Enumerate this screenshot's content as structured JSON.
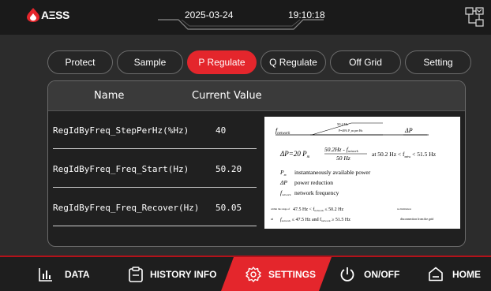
{
  "header": {
    "logo_text": "AΞSS",
    "date": "2025-03-24",
    "time": "19:10:18"
  },
  "tabs": [
    {
      "label": "Protect"
    },
    {
      "label": "Sample"
    },
    {
      "label": "P Regulate"
    },
    {
      "label": "Q Regulate"
    },
    {
      "label": "Off Grid"
    },
    {
      "label": "Setting"
    }
  ],
  "active_tab": "P Regulate",
  "table": {
    "col_name": "Name",
    "col_value": "Current Value",
    "rows": [
      {
        "name": "RegIdByFreq_StepPerHz(%Hz)",
        "value": "40"
      },
      {
        "name": "RegIdByFreq_Freq_Start(Hz)",
        "value": "50.20"
      },
      {
        "name": "RegIdByFreq_Freq_Recover(Hz)",
        "value": "50.05"
      }
    ]
  },
  "info_diagram": {
    "f_network": "f",
    "f_network_sub": "network",
    "dp": "ΔP",
    "fig_label_1": "50.2 Hz",
    "fig_label_2": "P=40% P_m per Hz",
    "formula_lhs": "ΔP=20 P",
    "formula_lhs_sub": "m",
    "formula_num": "50.2Hz - f",
    "formula_num_sub": "network",
    "formula_den": "50 Hz",
    "formula_cond": "at 50.2 Hz  < f",
    "formula_cond_sub": "netw",
    "formula_cond_end": " < 51.5 Hz",
    "legend": [
      {
        "sym": "P",
        "sub": "m",
        "text": "instantaneously available power"
      },
      {
        "sym": "ΔP",
        "sub": "",
        "text": "power reduction"
      },
      {
        "sym": "f",
        "sub": "network",
        "text": "network frequency"
      }
    ],
    "note_1_prefix": "within the range of",
    "note_1_mid": "47.5 Hz  <  f",
    "note_1_sub": "network",
    "note_1_end": " ≤  50.2 Hz",
    "note_1_tail": "no limitation",
    "note_2_prefix": "at",
    "note_2_mid": "f",
    "note_2_sub": "network",
    "note_2_mid2": " ≤ 47.5 Hz and f",
    "note_2_sub2": "network",
    "note_2_end": " ≥  51.5 Hz",
    "note_2_tail": "disconnection from the grid"
  },
  "bottom_nav": [
    {
      "label": "DATA",
      "icon": "bar-chart-icon"
    },
    {
      "label": "HISTORY INFO",
      "icon": "clipboard-icon"
    },
    {
      "label": "SETTINGS",
      "icon": "gear-icon"
    },
    {
      "label": "ON/OFF",
      "icon": "power-icon"
    },
    {
      "label": "HOME",
      "icon": "home-icon"
    }
  ],
  "colors": {
    "accent": "#e4262c",
    "background": "#2c2c2c",
    "header": "#1a1a1a"
  }
}
